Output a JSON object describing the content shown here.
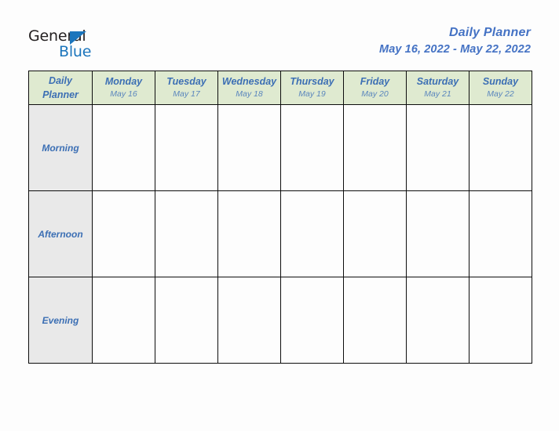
{
  "logo": {
    "word_one": "General",
    "word_two": "Blue",
    "triangle_icon": "triangle-icon",
    "colors": {
      "dark": "#231f20",
      "blue": "#1b75bc"
    }
  },
  "header": {
    "title": "Daily Planner",
    "date_range": "May 16, 2022 - May 22, 2022",
    "title_color": "#4472c4"
  },
  "table": {
    "corner": {
      "line1": "Daily",
      "line2": "Planner"
    },
    "header_bg": "#dfead0",
    "row_label_bg": "#e9e9e9",
    "border_color": "#0d0d0d",
    "text_color": "#3c6fb4",
    "columns": [
      {
        "day": "Monday",
        "date": "May 16"
      },
      {
        "day": "Tuesday",
        "date": "May 17"
      },
      {
        "day": "Wednesday",
        "date": "May 18"
      },
      {
        "day": "Thursday",
        "date": "May 19"
      },
      {
        "day": "Friday",
        "date": "May 20"
      },
      {
        "day": "Saturday",
        "date": "May 21"
      },
      {
        "day": "Sunday",
        "date": "May 22"
      }
    ],
    "rows": [
      {
        "label": "Morning",
        "cells": [
          "",
          "",
          "",
          "",
          "",
          "",
          ""
        ]
      },
      {
        "label": "Afternoon",
        "cells": [
          "",
          "",
          "",
          "",
          "",
          "",
          ""
        ]
      },
      {
        "label": "Evening",
        "cells": [
          "",
          "",
          "",
          "",
          "",
          "",
          ""
        ]
      }
    ]
  }
}
